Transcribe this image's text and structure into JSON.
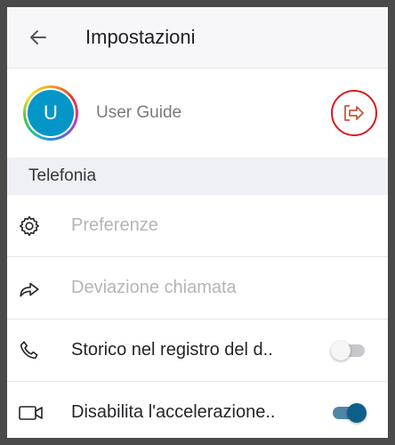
{
  "header": {
    "title": "Impostazioni",
    "back_icon": "arrow-left-icon"
  },
  "profile": {
    "avatar_initial": "U",
    "name": "User Guide",
    "logout_icon": "logout-icon",
    "logout_highlight_color": "#d81b1b"
  },
  "section": {
    "title": "Telefonia"
  },
  "rows": [
    {
      "label": "Preferenze",
      "icon": "gear-icon",
      "enabled": false
    },
    {
      "label": "Deviazione chiamata",
      "icon": "forward-arrow-icon",
      "enabled": false
    },
    {
      "label": "Storico nel registro del d..",
      "icon": "phone-icon",
      "enabled": true,
      "toggle": "off"
    },
    {
      "label": "Disabilita l'accelerazione..",
      "icon": "video-camera-icon",
      "enabled": true,
      "toggle": "on"
    }
  ],
  "colors": {
    "accent": "#0d5f8a",
    "avatar_bg": "#0596c8",
    "section_bg": "#eef0f4"
  }
}
